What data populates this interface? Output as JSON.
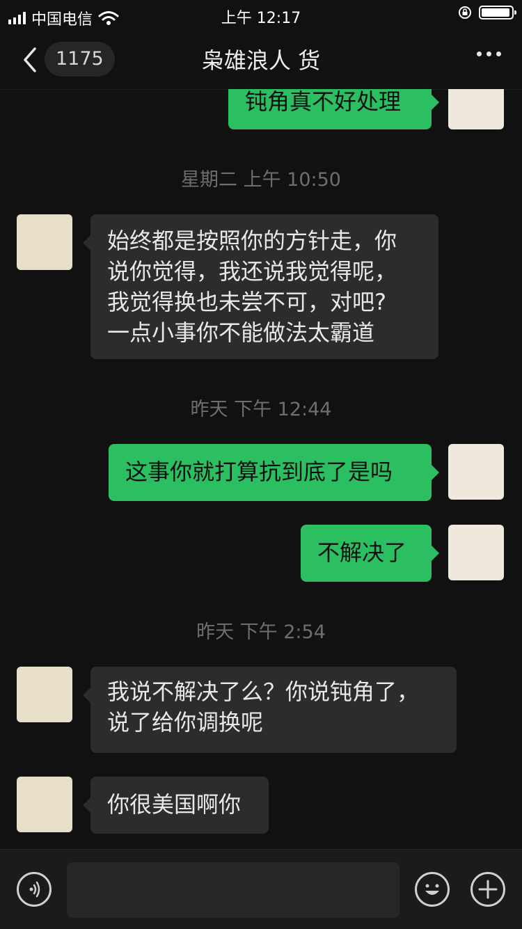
{
  "status_bar": {
    "carrier": "中国电信",
    "time": "上午 12:17"
  },
  "nav": {
    "back_count": "1175",
    "title": "枭雄浪人 货"
  },
  "messages": [
    {
      "text": "钝角真不好处理"
    },
    {
      "timestamp": "星期二 上午 10:50"
    },
    {
      "text": "始终都是按照你的方针走，你\n说你觉得，我还说我觉得呢，\n我觉得换也未尝不可，对吧?\n一点小事你不能做法太霸道"
    },
    {
      "timestamp": "昨天 下午 12:44"
    },
    {
      "text": "这事你就打算抗到底了是吗"
    },
    {
      "text": "不解决了"
    },
    {
      "timestamp": "昨天 下午 2:54"
    },
    {
      "text": "我说不解决了么？你说钝角了，\n说了给你调换呢"
    },
    {
      "text": "你很美国啊你"
    }
  ],
  "colors": {
    "outgoing_bubble": "#2bbf62",
    "incoming_bubble": "#2c2c2c",
    "background": "#111111"
  },
  "icons": [
    "signal-icon",
    "wifi-icon",
    "orientation-lock-icon",
    "battery-icon",
    "back-chevron-icon",
    "more-icon",
    "voice-icon",
    "emoji-icon",
    "plus-icon"
  ]
}
